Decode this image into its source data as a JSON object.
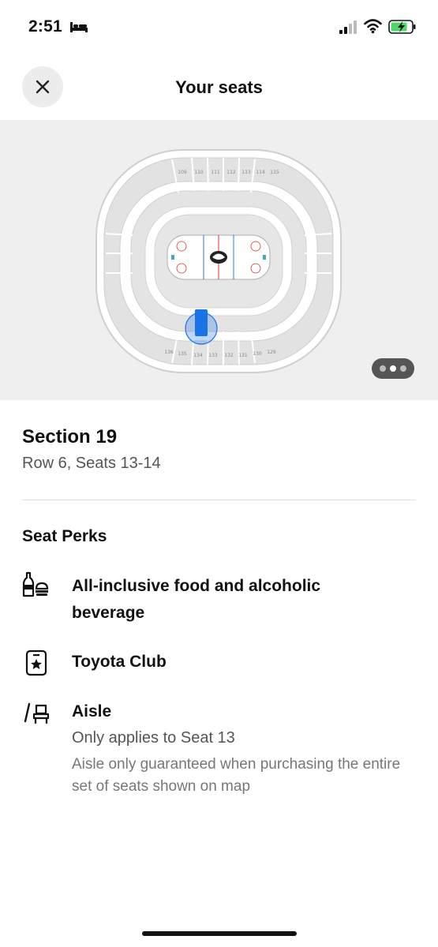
{
  "status_bar": {
    "time": "2:51",
    "icons": [
      "bed-icon",
      "cellular-signal-icon",
      "wifi-icon",
      "battery-charging-icon"
    ]
  },
  "header": {
    "title": "Your seats",
    "close_icon": "close-icon"
  },
  "seat_map": {
    "sections_upper": [
      "109",
      "110",
      "111",
      "112",
      "113",
      "114",
      "115"
    ],
    "sections_lower": [
      "136",
      "135",
      "134",
      "133",
      "132",
      "131",
      "130",
      "129"
    ],
    "highlighted_section": "19",
    "pager": {
      "pages": 3,
      "active_index": 1
    },
    "accent_color": "#1a73e8"
  },
  "seat": {
    "section": "Section 19",
    "details": "Row 6, Seats 13-14"
  },
  "perks": {
    "heading": "Seat Perks",
    "items": [
      {
        "icon": "food-drink-icon",
        "title": "All-inclusive food and alcoholic beverage"
      },
      {
        "icon": "club-badge-icon",
        "title": "Toyota Club"
      },
      {
        "icon": "aisle-seat-icon",
        "title": "Aisle",
        "subtitle": "Only applies to Seat 13",
        "note": "Aisle only guaranteed when purchasing the entire set of seats shown on map"
      }
    ]
  }
}
